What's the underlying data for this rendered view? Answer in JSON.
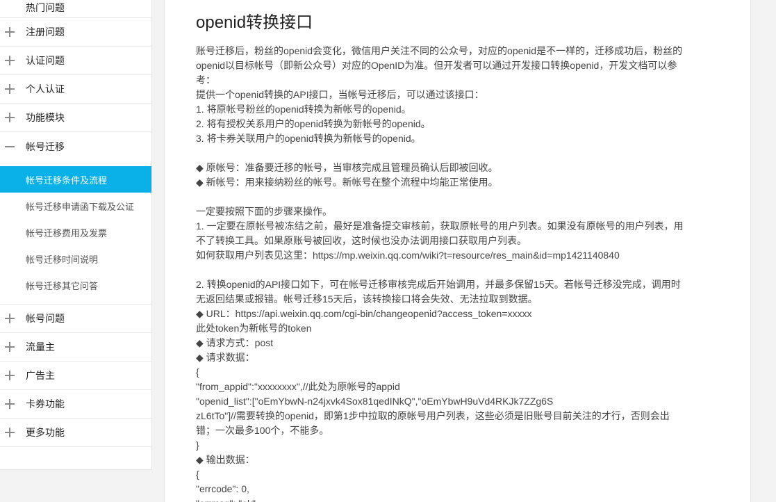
{
  "sidebar": {
    "top_item": "热门问题",
    "items_before": [
      {
        "label": "注册问题"
      },
      {
        "label": "认证问题"
      },
      {
        "label": "个人认证"
      },
      {
        "label": "功能模块"
      }
    ],
    "expanded_item": "帐号迁移",
    "sub_items": [
      {
        "label": "帐号迁移条件及流程"
      },
      {
        "label": "帐号迁移申请函下载及公证"
      },
      {
        "label": "帐号迁移费用及发票"
      },
      {
        "label": "帐号迁移时间说明"
      },
      {
        "label": "帐号迁移其它问答"
      }
    ],
    "items_after": [
      {
        "label": "帐号问题"
      },
      {
        "label": "流量主"
      },
      {
        "label": "广告主"
      },
      {
        "label": "卡券功能"
      },
      {
        "label": "更多功能"
      }
    ]
  },
  "article": {
    "title": "openid转换接口",
    "lines": [
      "账号迁移后，粉丝的openid会变化，微信用户关注不同的公众号，对应的openid是不一样的，迁移成功后，粉丝的",
      "openid以目标帐号（即新公众号）对应的OpenID为准。但开发者可以通过开发接口转换openid，开发文档可以参",
      "考：",
      "提供一个openid转换的API接口，当帐号迁移后，可以通过该接口：",
      "1. 将原帐号粉丝的openid转换为新帐号的openid。",
      "2. 将有授权关系用户的openid转换为新帐号的openid。",
      "3. 将卡券关联用户的openid转换为新帐号的openid。",
      "",
      "◆ 原帐号：准备要迁移的帐号，当审核完成且管理员确认后即被回收。",
      "◆ 新帐号：用来接纳粉丝的帐号。新帐号在整个流程中均能正常使用。",
      "",
      "一定要按照下面的步骤来操作。",
      "1. 一定要在原帐号被冻结之前，最好是准备提交审核前，获取原帐号的用户列表。如果没有原帐号的用户列表，用",
      "不了转换工具。如果原账号被回收，这时候也没办法调用接口获取用户列表。",
      "如何获取用户列表见这里：https://mp.weixin.qq.com/wiki?t=resource/res_main&id=mp1421140840",
      "",
      "2. 转换openid的API接口如下，可在帐号迁移审核完成后开始调用，并最多保留15天。若帐号迁移没完成，调用时",
      "无返回结果或报错。帐号迁移15天后，该转换接口将会失效、无法拉取到数据。",
      "◆ URL：https://api.weixin.qq.com/cgi-bin/changeopenid?access_token=xxxxx",
      "此处token为新帐号的token",
      "◆ 请求方式：post",
      "◆ 请求数据：",
      "{",
      "\"from_appid\":\"xxxxxxxx\",//此处为原帐号的appid",
      "\"openid_list\":[\"oEmYbwN-n24jxvk4Sox81qedINkQ\",\"oEmYbwH9uVd4RKJk7ZZg6S",
      "zL6tTo\"]//需要转换的openid，即第1步中拉取的原帐号用户列表，这些必须是旧账号目前关注的才行，否则会出",
      "错；一次最多100个，不能多。",
      "}",
      "◆ 输出数据：",
      "{",
      "\"errcode\": 0,",
      "\"errmsg\": \"ok\","
    ]
  }
}
